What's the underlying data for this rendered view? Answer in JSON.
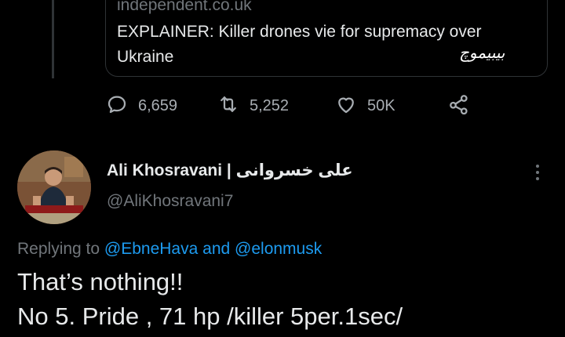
{
  "previous_tweet": {
    "link_card": {
      "domain": "independent.co.uk",
      "title": "EXPLAINER: Killer drones vie for supremacy over Ukraine"
    },
    "watermark_text": "بیبیموچ",
    "actions": {
      "reply_count": "6,659",
      "retweet_count": "5,252",
      "like_count": "50K"
    }
  },
  "reply_tweet": {
    "author_name": "Ali Khosravani | علی خسروانی",
    "author_handle": "@AliKhosravani7",
    "replying_to_prefix": "Replying to",
    "mention_1": "@EbneHava",
    "and_word": "and",
    "mention_2": "@elonmusk",
    "text_line_1": "That’s nothing!!",
    "text_line_2": "No 5. Pride , 71 hp /killer 5per.1sec/"
  },
  "colors": {
    "background": "#000000",
    "primary_text": "#e7e9ea",
    "secondary_text": "#71767b",
    "link": "#1d9bf0",
    "border": "#2f3336"
  },
  "icons": [
    "reply-icon",
    "retweet-icon",
    "heart-icon",
    "share-icon",
    "more-icon"
  ]
}
